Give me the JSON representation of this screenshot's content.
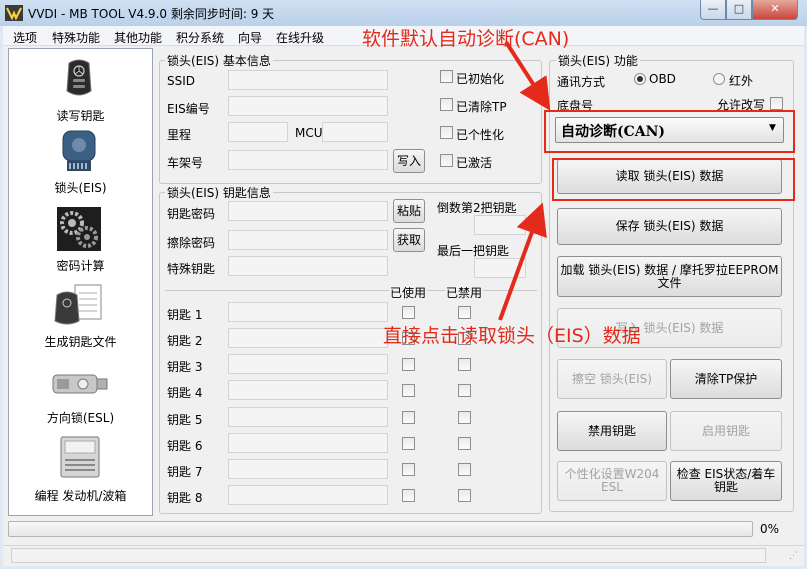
{
  "window": {
    "title": "VVDI - MB TOOL V4.9.0   剩余同步时间: 9 天",
    "buttons": {
      "minimize": "—",
      "maximize": "□",
      "close": "✕"
    }
  },
  "menu": [
    "选项",
    "特殊功能",
    "其他功能",
    "积分系统",
    "向导",
    "在线升级"
  ],
  "nav": [
    {
      "label": "读写钥匙",
      "icon": "car-key-icon"
    },
    {
      "label": "锁头(EIS)",
      "icon": "eis-module-icon"
    },
    {
      "label": "密码计算",
      "icon": "gears-icon"
    },
    {
      "label": "生成钥匙文件",
      "icon": "key-file-icon"
    },
    {
      "label": "方向锁(ESL)",
      "icon": "steering-lock-icon"
    },
    {
      "label": "编程 发动机/波箱",
      "icon": "ecu-icon"
    }
  ],
  "eis_basic": {
    "title": "锁头(EIS) 基本信息",
    "ssid_label": "SSID",
    "eis_no_label": "EIS编号",
    "mileage_label": "里程",
    "mcu_label": "MCU",
    "vin_label": "车架号",
    "write_button": "写入",
    "checks": [
      "已初始化",
      "已清除TP",
      "已个性化",
      "已激活"
    ]
  },
  "eis_keys": {
    "title": "锁头(EIS) 钥匙信息",
    "key_password_label": "钥匙密码",
    "paste_button": "粘贴",
    "erase_password_label": "擦除密码",
    "get_button": "获取",
    "special_key_label": "特殊钥匙",
    "second_last_key_label": "倒数第2把钥匙",
    "last_key_label": "最后一把钥匙",
    "used_header": "已使用",
    "disabled_header": "已禁用",
    "keys": [
      "钥匙 1",
      "钥匙 2",
      "钥匙 3",
      "钥匙 4",
      "钥匙 5",
      "钥匙 6",
      "钥匙 7",
      "钥匙 8"
    ]
  },
  "eis_function": {
    "title": "锁头(EIS) 功能",
    "comm_label": "通讯方式",
    "obd_label": "OBD",
    "ir_label": "红外",
    "chassis_label": "底盘号",
    "allow_modify_label": "允许改写",
    "mode_select": "自动诊断(CAN)",
    "buttons": {
      "read": "读取 锁头(EIS) 数据",
      "save": "保存 锁头(EIS) 数据",
      "load": "加载 锁头(EIS) 数据 / 摩托罗拉EEPROM文件",
      "write": "写入 锁头(EIS) 数据",
      "erase": "擦空 锁头(EIS)",
      "clear_tp": "清除TP保护",
      "disable_key": "禁用钥匙",
      "enable_key": "启用钥匙",
      "personalize": "个性化设置W204 ESL",
      "check_eis": "检查 EIS状态/着车钥匙"
    }
  },
  "progress": {
    "value": 0,
    "text": "0%"
  },
  "annotations": {
    "top": "软件默认自动诊断(CAN)",
    "bottom": "直接点击读取锁头（EIS）数据",
    "color": "#e32a1b"
  }
}
